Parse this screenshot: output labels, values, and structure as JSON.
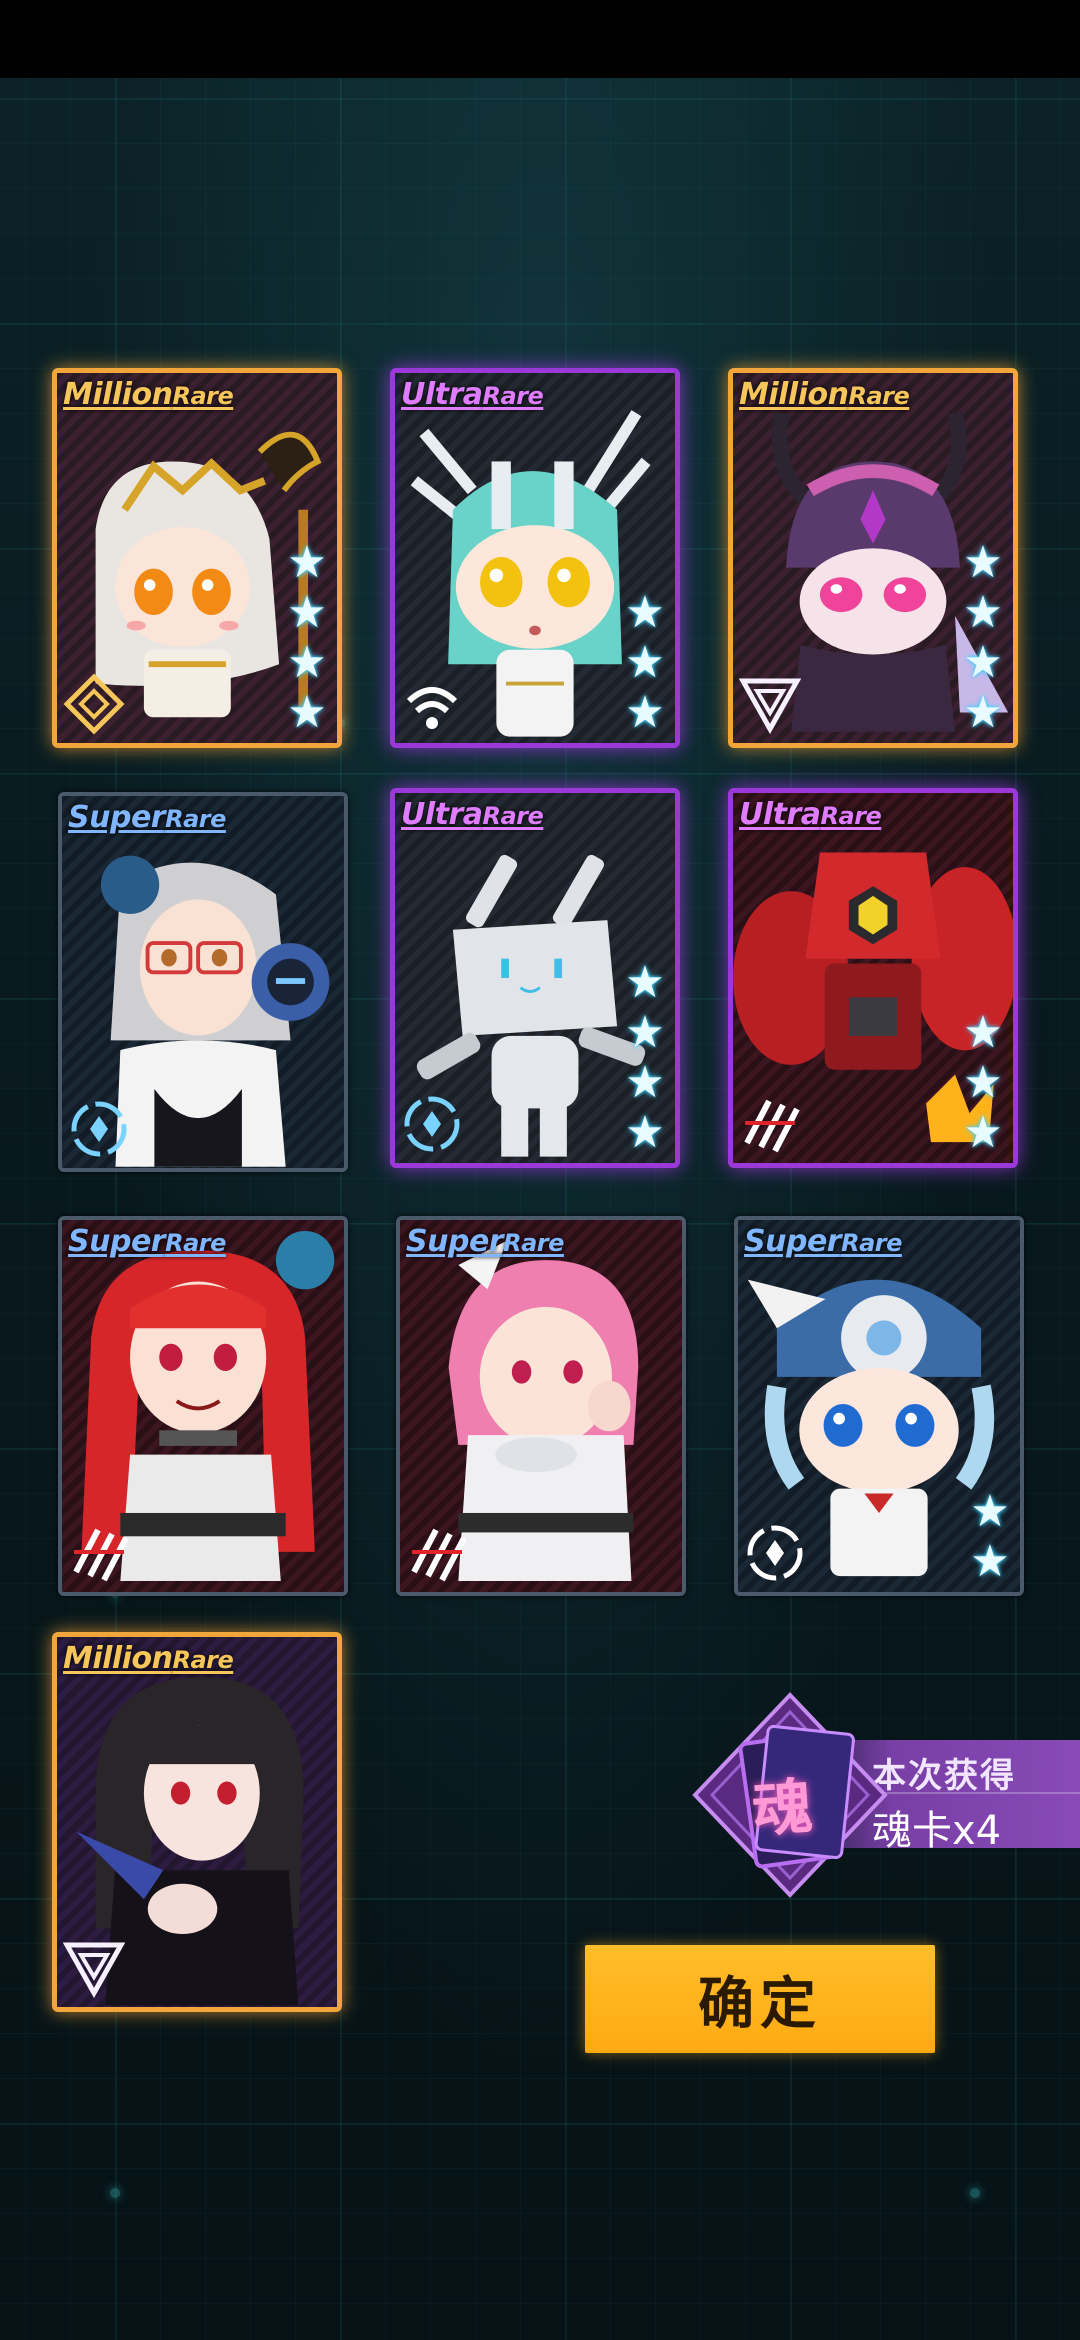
{
  "cards": [
    {
      "rarity_main": "Million",
      "rarity_suffix": "Rare",
      "tier": "million",
      "stars": 4,
      "class_icon": "diamond-class-icon"
    },
    {
      "rarity_main": "Ultra",
      "rarity_suffix": "Rare",
      "tier": "ultra",
      "stars": 3,
      "class_icon": "signal-class-icon"
    },
    {
      "rarity_main": "Million",
      "rarity_suffix": "Rare",
      "tier": "million",
      "stars": 4,
      "class_icon": "triangle-class-icon"
    },
    {
      "rarity_main": "Super",
      "rarity_suffix": "Rare",
      "tier": "super",
      "stars": 0,
      "class_icon": "ring-class-icon"
    },
    {
      "rarity_main": "Ultra",
      "rarity_suffix": "Rare",
      "tier": "ultra",
      "stars": 4,
      "class_icon": "ring-class-icon"
    },
    {
      "rarity_main": "Ultra",
      "rarity_suffix": "Rare",
      "tier": "ultra",
      "stars": 3,
      "class_icon": "stripes-class-icon"
    },
    {
      "rarity_main": "Super",
      "rarity_suffix": "Rare",
      "tier": "super",
      "stars": 0,
      "class_icon": "stripes-class-icon"
    },
    {
      "rarity_main": "Super",
      "rarity_suffix": "Rare",
      "tier": "super",
      "stars": 0,
      "class_icon": "stripes-class-icon"
    },
    {
      "rarity_main": "Super",
      "rarity_suffix": "Rare",
      "tier": "super",
      "stars": 2,
      "class_icon": "ring-class-icon"
    },
    {
      "rarity_main": "Million",
      "rarity_suffix": "Rare",
      "tier": "million",
      "stars": 0,
      "class_icon": "triangle-class-icon"
    }
  ],
  "reward": {
    "icon_char": "魂",
    "title": "本次获得",
    "amount_text": "魂卡x4"
  },
  "confirm_label": "确定",
  "colors": {
    "million": "#f2a53a",
    "ultra": "#9a39d8",
    "super": "#4b5a6a",
    "star_glow": "#3fd2ff",
    "button": "#ffb01a"
  }
}
